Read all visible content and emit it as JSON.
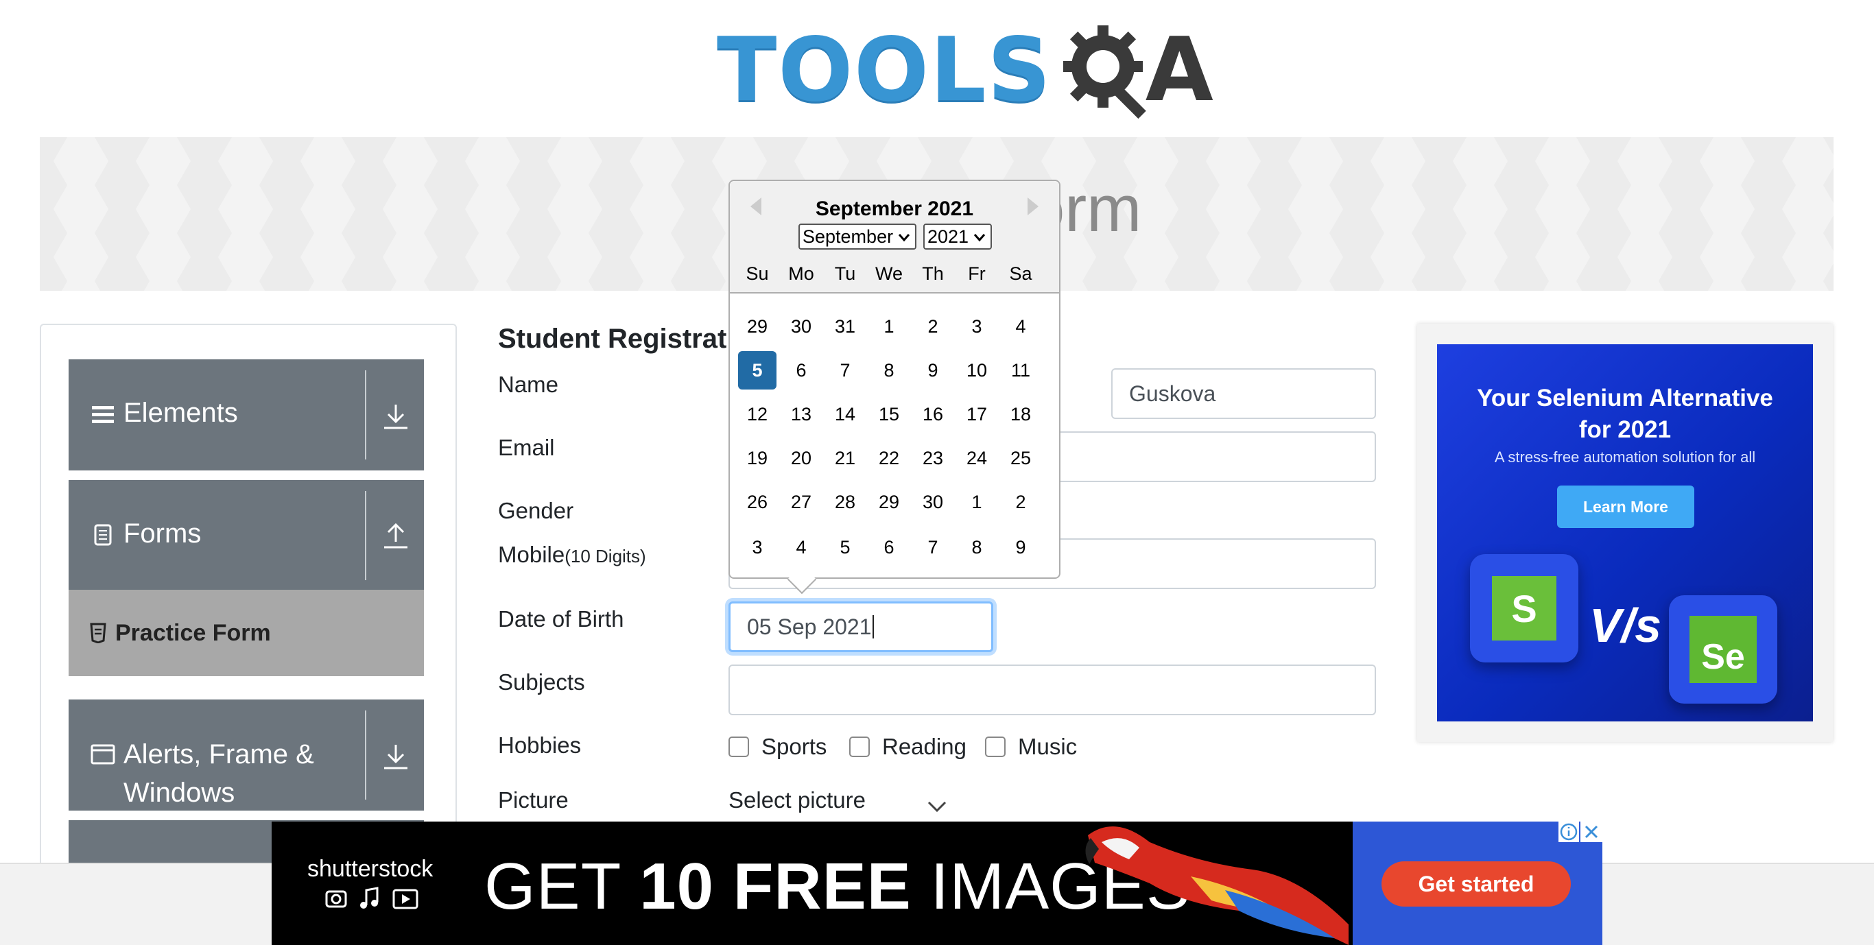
{
  "logo": {
    "part1": "TOOLS",
    "part2": "A"
  },
  "banner": {
    "title": "Practice Form"
  },
  "sidebar": {
    "groups": [
      {
        "label": "Elements",
        "icon": "hamburger-icon",
        "toggle": "download-icon"
      },
      {
        "label": "Forms",
        "icon": "document-icon",
        "toggle": "upload-icon"
      },
      {
        "label": "Alerts, Frame & Windows",
        "icon": "window-icon",
        "toggle": "download-icon"
      }
    ],
    "active_item": "Practice Form"
  },
  "form": {
    "title": "Student Registration Form",
    "labels": {
      "name": "Name",
      "email": "Email",
      "gender": "Gender",
      "mobile": "Mobile",
      "mobile_hint": "(10 Digits)",
      "dob": "Date of Birth",
      "subjects": "Subjects",
      "hobbies": "Hobbies",
      "picture": "Picture"
    },
    "last_name_value": "Guskova",
    "dob_value": "05 Sep 2021",
    "hobbies": [
      "Sports",
      "Reading",
      "Music"
    ],
    "picture_select": "Select picture"
  },
  "datepicker": {
    "title": "September 2021",
    "month_select": "September",
    "year_select": "2021",
    "weekdays": [
      "Su",
      "Mo",
      "Tu",
      "We",
      "Th",
      "Fr",
      "Sa"
    ],
    "weeks": [
      [
        "29",
        "30",
        "31",
        "1",
        "2",
        "3",
        "4"
      ],
      [
        "5",
        "6",
        "7",
        "8",
        "9",
        "10",
        "11"
      ],
      [
        "12",
        "13",
        "14",
        "15",
        "16",
        "17",
        "18"
      ],
      [
        "19",
        "20",
        "21",
        "22",
        "23",
        "24",
        "25"
      ],
      [
        "26",
        "27",
        "28",
        "29",
        "30",
        "1",
        "2"
      ],
      [
        "3",
        "4",
        "5",
        "6",
        "7",
        "8",
        "9"
      ]
    ],
    "selected_day": "5"
  },
  "right_ad": {
    "headline": "Your Selenium Alternative for 2021",
    "subtext": "A stress-free automation solution for all",
    "button": "Learn More",
    "left_logo": "S",
    "vs": "V/s",
    "right_logo": "Se"
  },
  "bottom_ad": {
    "brand": "shutterstock",
    "headline_pre": "GET ",
    "headline_bold": "10 FREE",
    "headline_post": " IMAGES",
    "cta": "Get started"
  },
  "colors": {
    "sidebar_bg": "#6c757d",
    "active_bg": "#a8a8a8",
    "selected_day": "#216ba5",
    "focus_border": "#80bdff",
    "logo_blue": "#3895d3"
  }
}
